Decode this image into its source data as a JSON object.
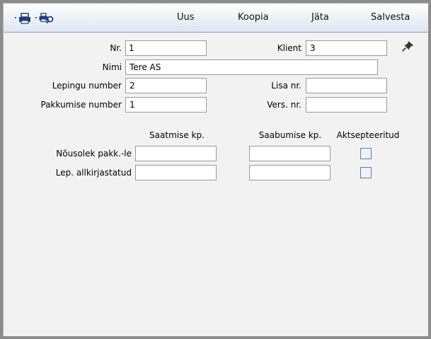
{
  "toolbar": {
    "print_icon": "printer-icon",
    "preview_icon": "print-preview-icon",
    "new_label": "Uus",
    "copy_label": "Koopia",
    "discard_label": "Jäta",
    "save_label": "Salvesta"
  },
  "form": {
    "nr": {
      "label": "Nr.",
      "value": "1"
    },
    "client": {
      "label": "Klient",
      "value": "3"
    },
    "name": {
      "label": "Nimi",
      "value": "Tere AS"
    },
    "contract_number": {
      "label": "Lepingu number",
      "value": "2"
    },
    "extra_nr": {
      "label": "Lisa nr.",
      "value": ""
    },
    "offer_number": {
      "label": "Pakkumise number",
      "value": "1"
    },
    "version_nr": {
      "label": "Vers. nr.",
      "value": ""
    },
    "pin_icon": "pushpin-icon"
  },
  "dates": {
    "col_sent": "Saatmise kp.",
    "col_received": "Saabumise kp.",
    "col_accepted": "Aktsepteeritud",
    "rows": [
      {
        "label": "Nõusolek pakk.-le",
        "sent": "",
        "received": "",
        "accepted": false
      },
      {
        "label": "Lep. allkirjastatud",
        "sent": "",
        "received": "",
        "accepted": false
      }
    ]
  }
}
